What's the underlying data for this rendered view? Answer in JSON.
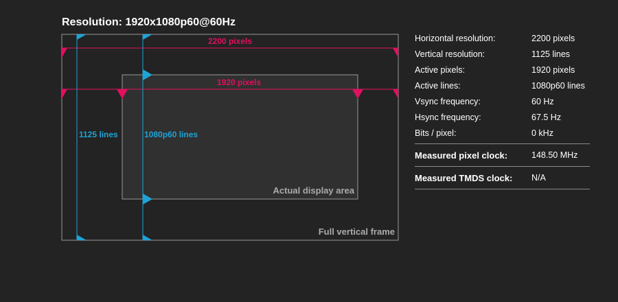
{
  "title": "Resolution: 1920x1080p60@60Hz",
  "colors": {
    "horizontal": "#e0105f",
    "vertical": "#1fa3d6",
    "frame": "#9a9a9a",
    "area_label": "#aaaaaa"
  },
  "diagram": {
    "total_width_label": "2200 pixels",
    "active_width_label": "1920 pixels",
    "total_height_label": "1125 lines",
    "active_height_label": "1080p60 lines",
    "active_area_label": "Actual display area",
    "full_frame_label": "Full vertical frame"
  },
  "stats": [
    {
      "key": "Horizontal resolution:",
      "value": "2200 pixels"
    },
    {
      "key": "Vertical resolution:",
      "value": "1125 lines"
    },
    {
      "key": "Active pixels:",
      "value": "1920 pixels"
    },
    {
      "key": "Active lines:",
      "value": "1080p60 lines"
    },
    {
      "key": "Vsync frequency:",
      "value": "60 Hz"
    },
    {
      "key": "Hsync frequency:",
      "value": "67.5 Hz"
    },
    {
      "key": "Bits / pixel:",
      "value": "0 kHz"
    }
  ],
  "measured": [
    {
      "key": "Measured pixel clock:",
      "value": "148.50 MHz"
    },
    {
      "key": "Measured TMDS clock:",
      "value": "N/A"
    }
  ]
}
